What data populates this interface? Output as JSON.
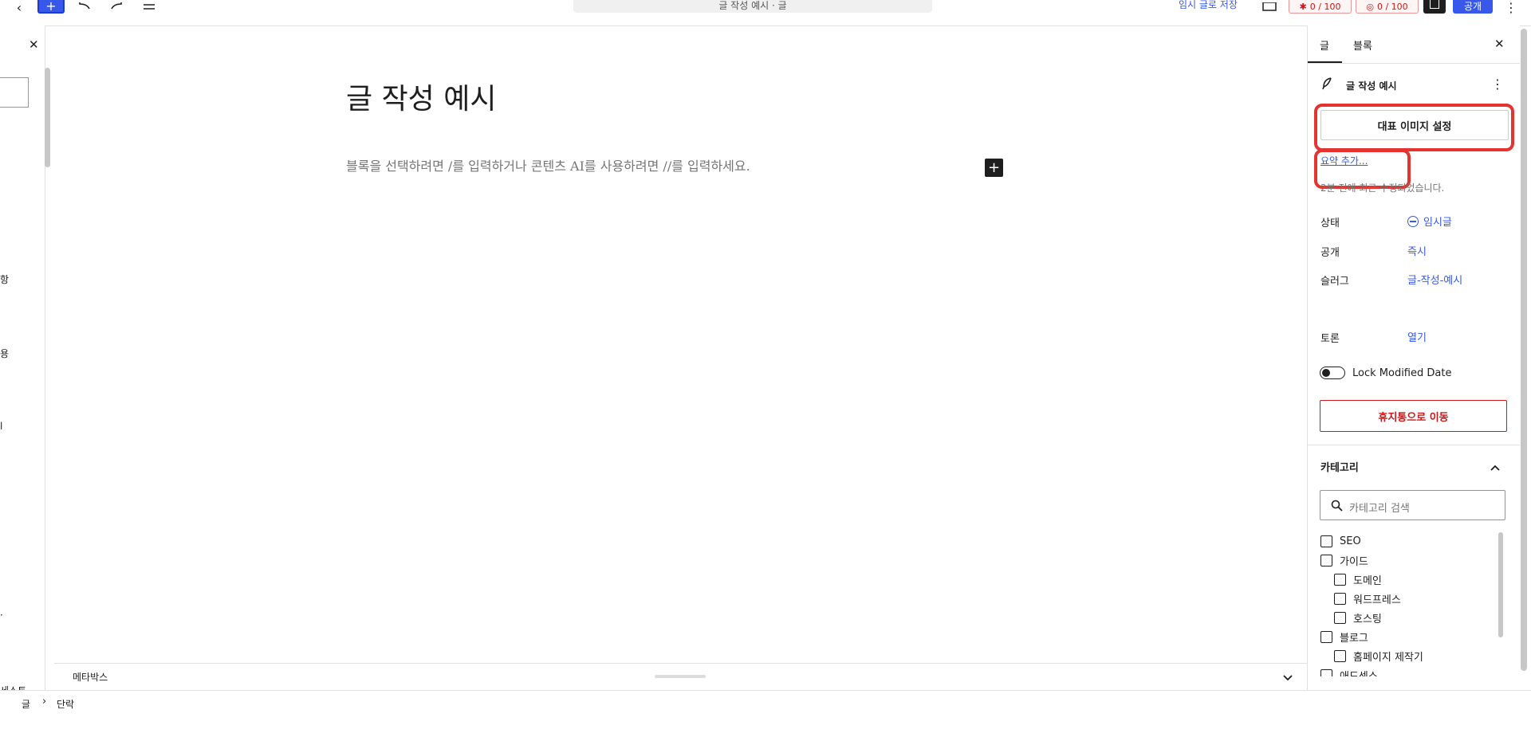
{
  "topbar": {
    "back_icon": "chevron-left-icon",
    "add_icon": "plus-icon",
    "undo_icon": "undo-icon",
    "redo_icon": "redo-icon",
    "outline_icon": "list-view-icon",
    "doc_title": "글 작성 예시 · 글",
    "save_draft": "임시 글로 저장",
    "badge1": "0 / 100",
    "badge2": "0 / 100",
    "publish": "공개"
  },
  "left_panel": {
    "close": "✕",
    "fragments": [
      "항",
      "용",
      "l",
      "·",
      "세스트"
    ]
  },
  "editor": {
    "title": "글 작성 예시",
    "placeholder": "블록을 선택하려면 /를 입력하거나 콘텐츠 AI를 사용하려면 //를 입력하세요.",
    "add_block": "+"
  },
  "metabox": {
    "label": "메타박스"
  },
  "breadcrumb": {
    "root": "글",
    "separator": "›",
    "current": "단락"
  },
  "sidebar": {
    "tabs": [
      "글",
      "블록"
    ],
    "post_title": "글 작성 예시",
    "featured_image": "대표 이미지 설정",
    "excerpt": "요약 추가...",
    "last_edited": "2분 전에 최근 수정되었습니다.",
    "rows": [
      {
        "label": "상태",
        "value": "임시글"
      },
      {
        "label": "공개",
        "value": "즉시"
      },
      {
        "label": "슬러그",
        "value": "글-작성-예시"
      },
      {
        "label": "토론",
        "value": "열기"
      }
    ],
    "lock_modified": "Lock Modified Date",
    "trash": "휴지통으로 이동",
    "categories_title": "카테고리",
    "category_search_placeholder": "카테고리 검색",
    "categories": [
      {
        "name": "SEO",
        "level": 0
      },
      {
        "name": "가이드",
        "level": 0
      },
      {
        "name": "도메인",
        "level": 1
      },
      {
        "name": "워드프레스",
        "level": 1
      },
      {
        "name": "호스팅",
        "level": 1
      },
      {
        "name": "블로그",
        "level": 0
      },
      {
        "name": "홈페이지 제작기",
        "level": 1
      },
      {
        "name": "애드센스",
        "level": 0
      }
    ]
  },
  "colors": {
    "accent": "#3858e9",
    "danger": "#cc1818",
    "highlight": "#e3342f"
  }
}
